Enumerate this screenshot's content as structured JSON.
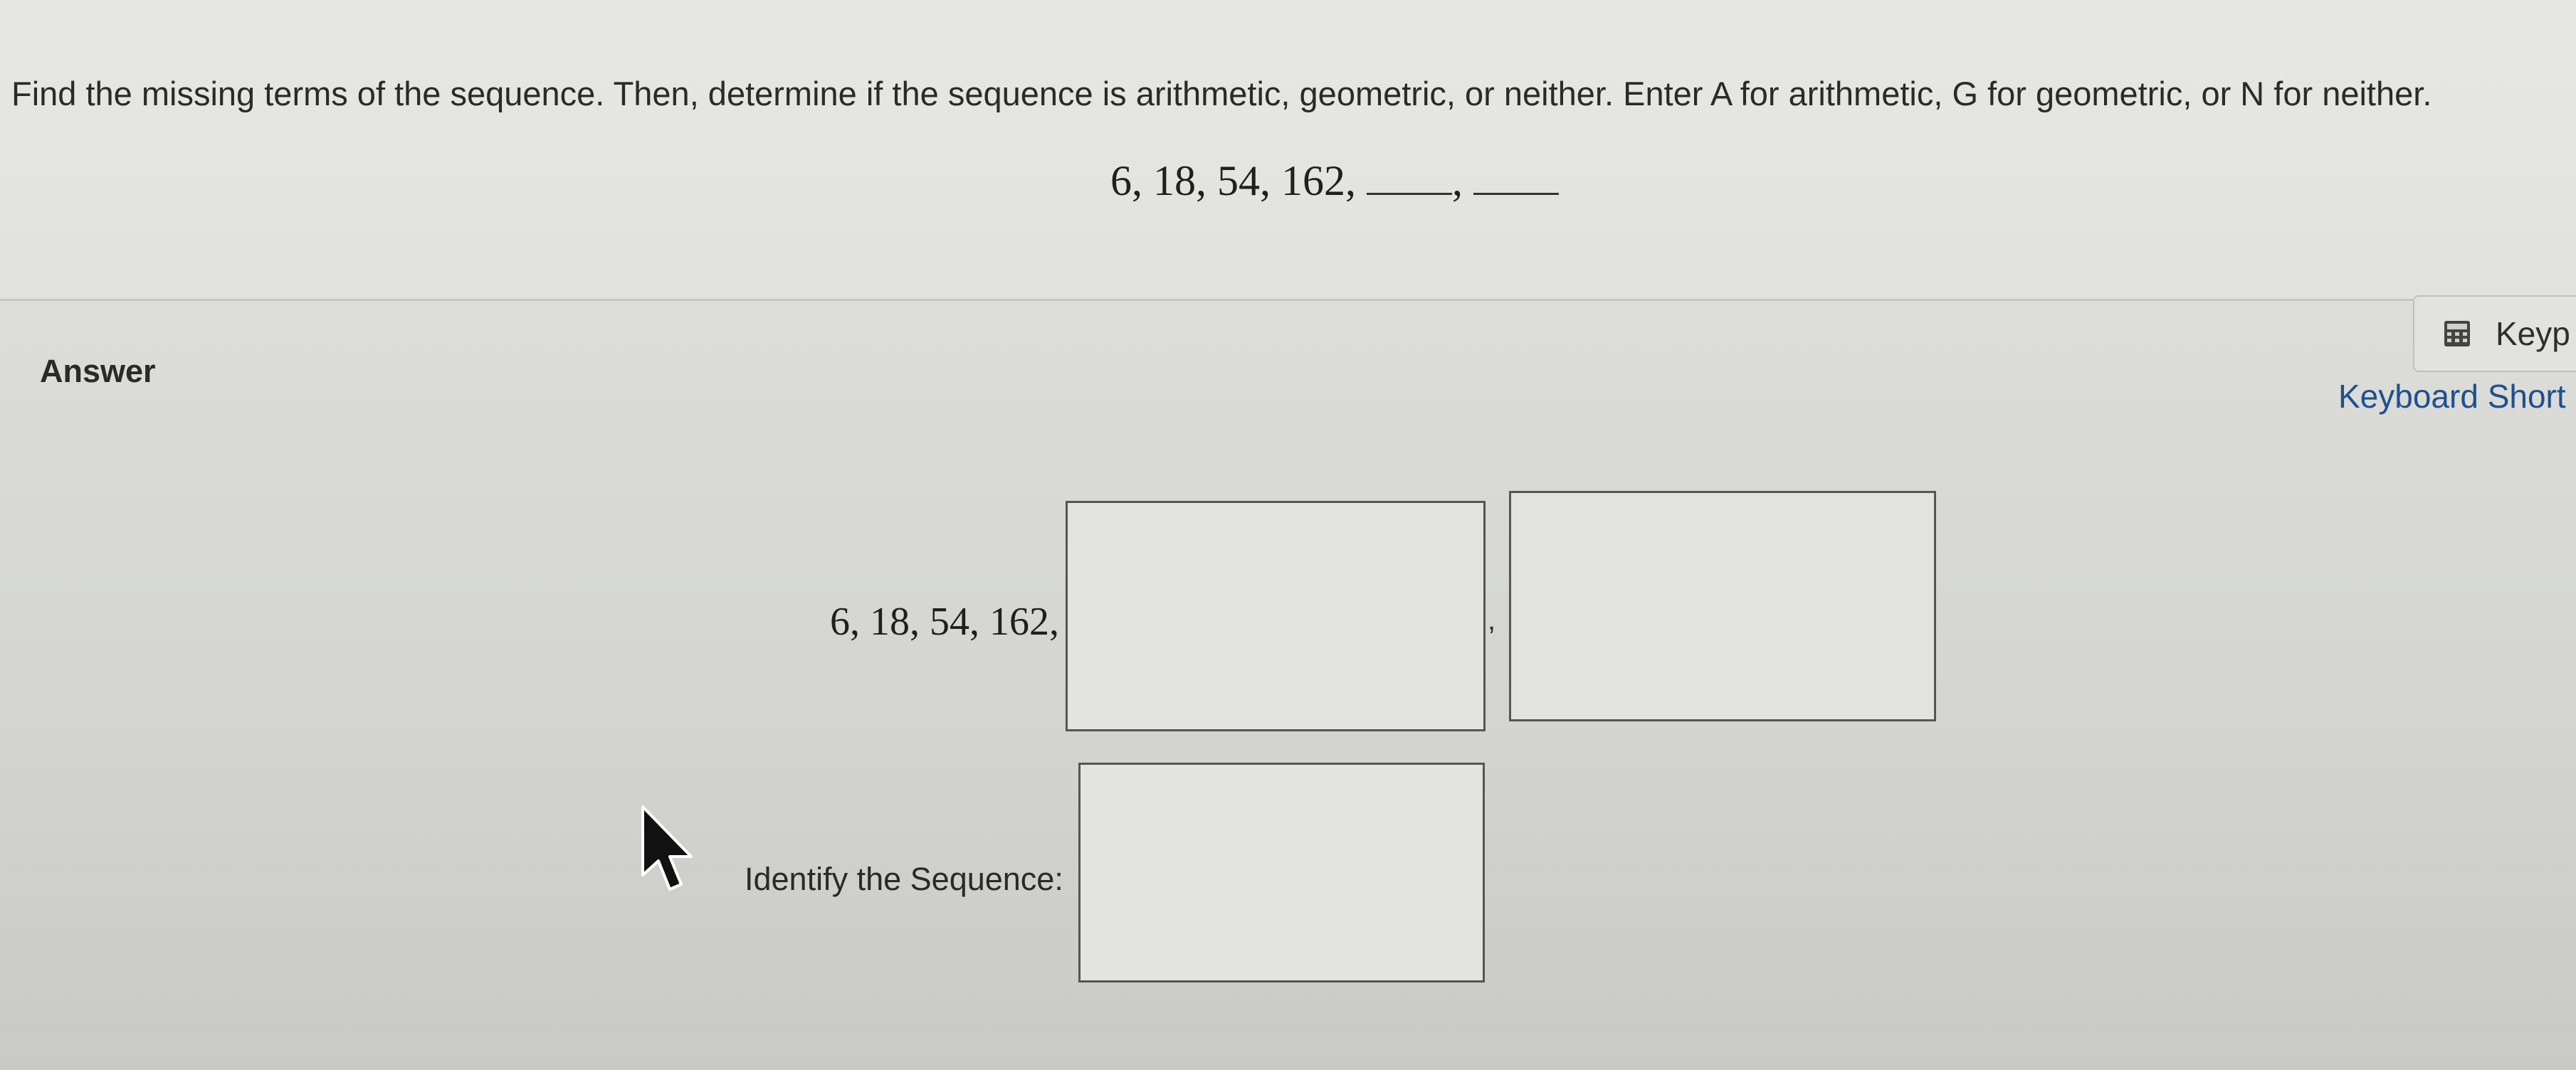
{
  "question": {
    "instruction": "Find the missing terms of the sequence. Then, determine if the sequence is arithmetic, geometric, or neither. Enter A for arithmetic, G for geometric, or N for neither.",
    "sequence": "6, 18, 54, 162,"
  },
  "answer": {
    "label": "Answer",
    "sequence_prefix": "6, 18, 54, 162,",
    "separator": ",",
    "term5_value": "",
    "term6_value": "",
    "identify_label": "Identify the Sequence:",
    "identify_value": ""
  },
  "toolbar": {
    "keypad_label": "Keyp",
    "keypad_icon": "calculator-icon",
    "shortcuts_label": "Keyboard Short"
  }
}
